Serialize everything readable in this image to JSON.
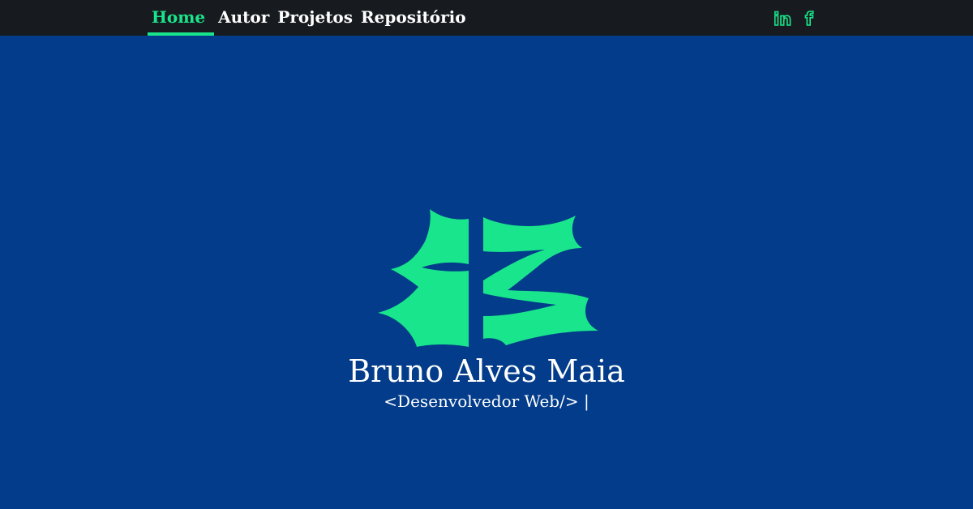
{
  "nav": {
    "items": [
      {
        "label": "Home",
        "active": true
      },
      {
        "label": "Autor",
        "active": false
      },
      {
        "label": "Projetos",
        "active": false
      },
      {
        "label": "Repositório",
        "active": false
      }
    ]
  },
  "social": {
    "icons": [
      "linkedin-icon",
      "facebook-icon"
    ],
    "linkedin_glyph": "in",
    "facebook_glyph": "f"
  },
  "hero": {
    "name": "Bruno Alves Maia",
    "role": "<Desenvolvedor Web/> |"
  },
  "colors": {
    "background": "#023c8a",
    "topbar": "#171b1f",
    "accent": "#19e68c",
    "text": "#ffffff"
  }
}
